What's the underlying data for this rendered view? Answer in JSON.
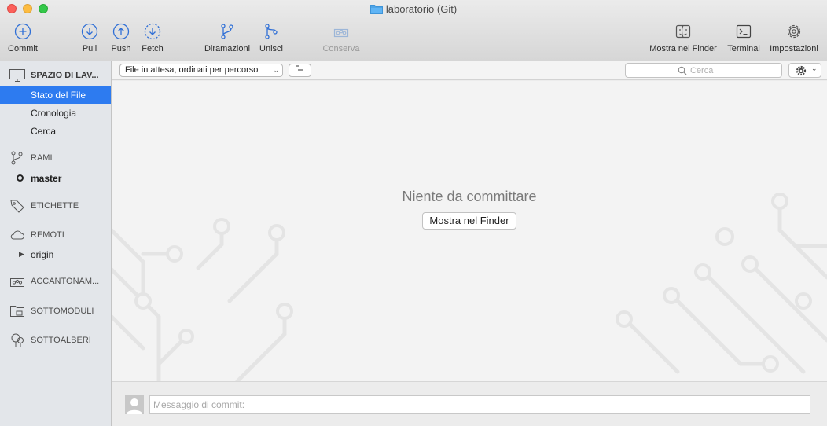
{
  "window": {
    "title": "laboratorio (Git)"
  },
  "toolbar": {
    "commit": "Commit",
    "pull": "Pull",
    "push": "Push",
    "fetch": "Fetch",
    "branch": "Diramazioni",
    "merge": "Unisci",
    "stash": "Conserva",
    "show_in_finder": "Mostra nel Finder",
    "terminal": "Terminal",
    "settings": "Impostazioni"
  },
  "sidebar": {
    "workspace": "SPAZIO DI LAV...",
    "file_status": "Stato del File",
    "history": "Cronologia",
    "search": "Cerca",
    "branches": "RAMI",
    "current_branch": "master",
    "tags": "ETICHETTE",
    "remotes": "REMOTI",
    "remote_origin": "origin",
    "stashes": "ACCANTONAM...",
    "submodules": "SOTTOMODULI",
    "subtrees": "SOTTOALBERI"
  },
  "filter": {
    "selected": "File in attesa, ordinati per percorso",
    "search_placeholder": "Cerca"
  },
  "main": {
    "empty_message": "Niente da committare",
    "finder_button": "Mostra nel Finder"
  },
  "commit": {
    "placeholder": "Messaggio di commit:"
  },
  "colors": {
    "accent": "#2d7bf0",
    "toolbar_icon": "#2f6fd6"
  }
}
